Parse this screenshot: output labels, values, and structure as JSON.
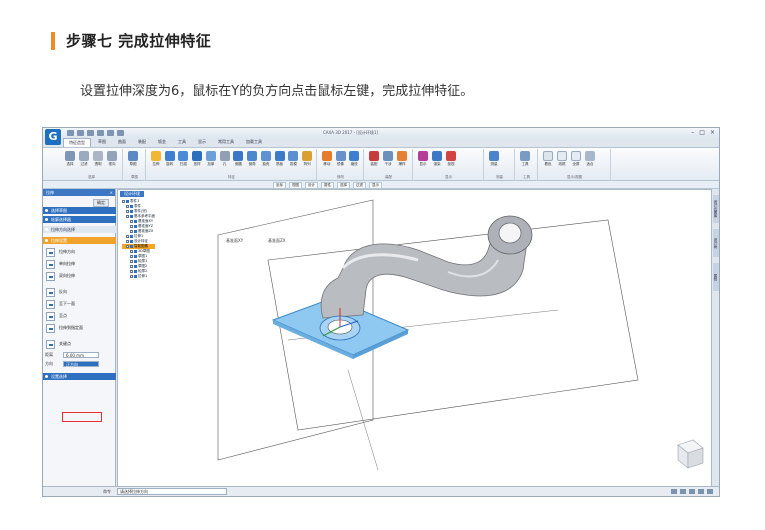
{
  "article": {
    "step_title": "步骤七  完成拉伸特征",
    "description": "设置拉伸深度为6，鼠标在Y的负方向点击鼠标左键，完成拉伸特征。"
  },
  "app": {
    "logo_letter": "G",
    "window_title": "CAXA 3D 2017 - [设计环境1]",
    "tabs": [
      "特征造型",
      "草图",
      "曲面",
      "装配",
      "钣金",
      "工具",
      "显示",
      "常用工具",
      "加载工具"
    ],
    "active_tab": "特征造型",
    "ribbon_groups": [
      {
        "label": "选择",
        "buttons": [
          "选择",
          "过滤",
          "透明",
          "视向",
          "扫描"
        ]
      },
      {
        "label": "草图",
        "buttons": [
          "草图"
        ]
      },
      {
        "label": "特征",
        "buttons": [
          "拉伸",
          "旋转",
          "扫描",
          "放样",
          "加厚",
          "孔",
          "倒圆",
          "倒角",
          "抽壳",
          "筋板",
          "拔模",
          "阵列"
        ]
      },
      {
        "label": "修改",
        "buttons": [
          "移动",
          "镜像",
          "缩放"
        ]
      },
      {
        "label": "装配",
        "buttons": [
          "装配",
          "干涉",
          "爆炸"
        ]
      },
      {
        "label": "显示",
        "buttons": [
          "显示",
          "渲染",
          "剖视"
        ]
      },
      {
        "label": "测量",
        "buttons": [
          "测量",
          "分析"
        ]
      },
      {
        "label": "工具",
        "buttons": [
          "工具"
        ]
      },
      {
        "label": "显示/视图",
        "buttons": [
          "着色",
          "线框",
          "全屏",
          "适合"
        ]
      }
    ],
    "subtoolbar": [
      "坐标",
      "视图",
      "设计",
      "属性",
      "选择",
      "过滤",
      "显示"
    ],
    "panel": {
      "title": "拉伸",
      "ok_label": "确定",
      "sections": [
        "选择草图",
        "轮廓选择器",
        "拉伸方向选择",
        "拉伸设置",
        "设置选择"
      ],
      "options": [
        "拉伸方向",
        "单向拉伸",
        "双向拉伸",
        "反向",
        "至下一面",
        "至点",
        "拉伸到指定面"
      ],
      "sub_option": "关键点",
      "depth_label": "距离",
      "depth_value": "6.00 mm",
      "side_label": "方向",
      "side_value": "正方向"
    },
    "viewport_tab": "设计环境",
    "tree": [
      {
        "label": "零件1",
        "level": 0
      },
      {
        "label": "零件",
        "level": 1
      },
      {
        "label": "零件(完)",
        "level": 1
      },
      {
        "label": "基本参考平面",
        "level": 1
      },
      {
        "label": "基准面XY",
        "level": 2
      },
      {
        "label": "基准面YZ",
        "level": 2
      },
      {
        "label": "基准面ZX",
        "level": 2
      },
      {
        "label": "拉伸1",
        "level": 1
      },
      {
        "label": "设计特征",
        "level": 1
      },
      {
        "label": "智能图素",
        "level": 1,
        "highlight": true
      },
      {
        "label": "3D草图",
        "level": 2
      },
      {
        "label": "草图1",
        "level": 2
      },
      {
        "label": "轮廓1",
        "level": 2
      },
      {
        "label": "草图2",
        "level": 2
      },
      {
        "label": "轮廓2",
        "level": 2
      },
      {
        "label": "拉伸1",
        "level": 2
      }
    ],
    "plane_labels": [
      "基准面XY",
      "基准面ZX"
    ],
    "right_dock": [
      "设计元素库",
      "设计树",
      "属性"
    ],
    "command_label": "命令",
    "command_text": "请选择拉伸方向"
  },
  "colors": {
    "accent_bar": "#f08a24",
    "panel_section": "#2e6fc0",
    "highlight": "#f5a623",
    "pipe": "#b9bcc1",
    "plate": "#8fc8f0",
    "red_box": "#e23030"
  }
}
